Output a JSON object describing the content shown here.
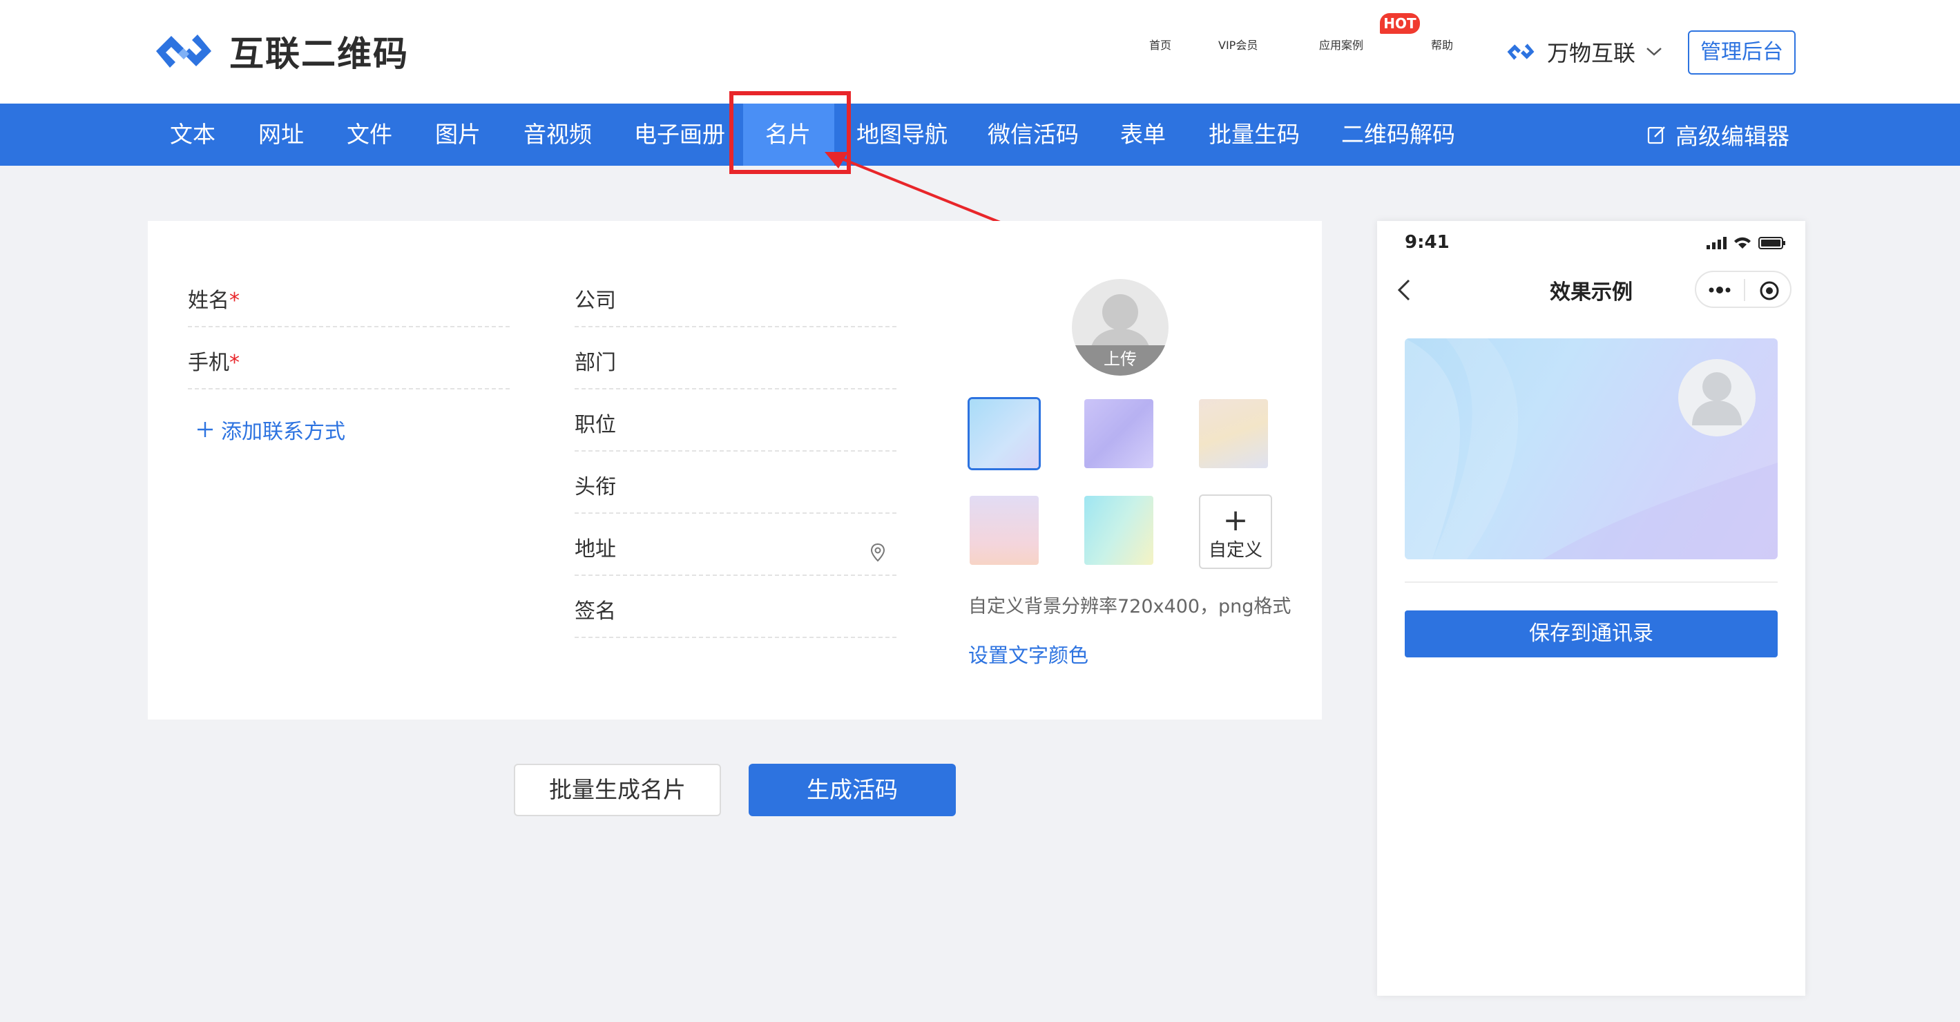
{
  "brand": {
    "name": "互联二维码",
    "accent": "#2d73e0"
  },
  "topnav": {
    "home": "首页",
    "vip": "VIP会员",
    "cases": "应用案例",
    "hot_badge": "HOT",
    "help": "帮助",
    "account": "万物互联",
    "admin": "管理后台"
  },
  "tabs": {
    "text": "文本",
    "url": "网址",
    "file": "文件",
    "image": "图片",
    "av": "音视频",
    "album": "电子画册",
    "vcard": "名片",
    "map": "地图导航",
    "wechat": "微信活码",
    "form": "表单",
    "batch": "批量生码",
    "decode": "二维码解码",
    "advanced": "高级编辑器"
  },
  "active_tab": "名片",
  "form": {
    "name_label": "姓名",
    "phone_label": "手机",
    "required_mark": "*",
    "add_contact": "添加联系方式",
    "company_label": "公司",
    "department_label": "部门",
    "position_label": "职位",
    "title_label": "头衔",
    "address_label": "地址",
    "signature_label": "签名"
  },
  "avatar": {
    "upload_label": "上传"
  },
  "backgrounds": {
    "custom_label": "自定义",
    "note": "自定义背景分辨率720x400，png格式",
    "text_color_link": "设置文字颜色"
  },
  "actions": {
    "batch": "批量生成名片",
    "generate": "生成活码"
  },
  "preview": {
    "time": "9:41",
    "title": "效果示例",
    "save_button": "保存到通讯录"
  }
}
